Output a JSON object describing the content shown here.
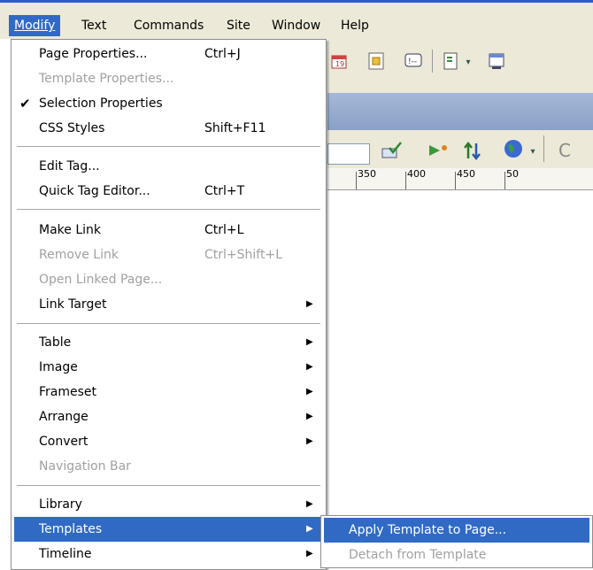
{
  "menubar": {
    "items": [
      {
        "label": "Modify",
        "active": true
      },
      {
        "label": "Text"
      },
      {
        "label": "Commands"
      },
      {
        "label": "Site"
      },
      {
        "label": "Window"
      },
      {
        "label": "Help"
      }
    ]
  },
  "ruler": {
    "labels": [
      "350",
      "400",
      "450",
      "50"
    ]
  },
  "menu": {
    "page_properties": {
      "label": "Page Properties...",
      "shortcut": "Ctrl+J"
    },
    "template_properties": {
      "label": "Template Properties..."
    },
    "selection_properties": {
      "label": "Selection Properties",
      "check": "✔"
    },
    "css_styles": {
      "label": "CSS Styles",
      "shortcut": "Shift+F11"
    },
    "edit_tag": {
      "label": "Edit Tag..."
    },
    "quick_tag_editor": {
      "label": "Quick Tag Editor...",
      "shortcut": "Ctrl+T"
    },
    "make_link": {
      "label": "Make Link",
      "shortcut": "Ctrl+L"
    },
    "remove_link": {
      "label": "Remove Link",
      "shortcut": "Ctrl+Shift+L"
    },
    "open_linked_page": {
      "label": "Open Linked Page..."
    },
    "link_target": {
      "label": "Link Target"
    },
    "table": {
      "label": "Table"
    },
    "image": {
      "label": "Image"
    },
    "frameset": {
      "label": "Frameset"
    },
    "arrange": {
      "label": "Arrange"
    },
    "convert": {
      "label": "Convert"
    },
    "navigation_bar": {
      "label": "Navigation Bar"
    },
    "library": {
      "label": "Library"
    },
    "templates": {
      "label": "Templates"
    },
    "timeline": {
      "label": "Timeline"
    }
  },
  "submenu": {
    "apply_template": {
      "label": "Apply Template to Page..."
    },
    "detach_template": {
      "label": "Detach from Template"
    }
  },
  "colors": {
    "highlight": "#316ac5",
    "menubar_bg": "#ece9d8",
    "disabled": "#a0a0a0"
  }
}
